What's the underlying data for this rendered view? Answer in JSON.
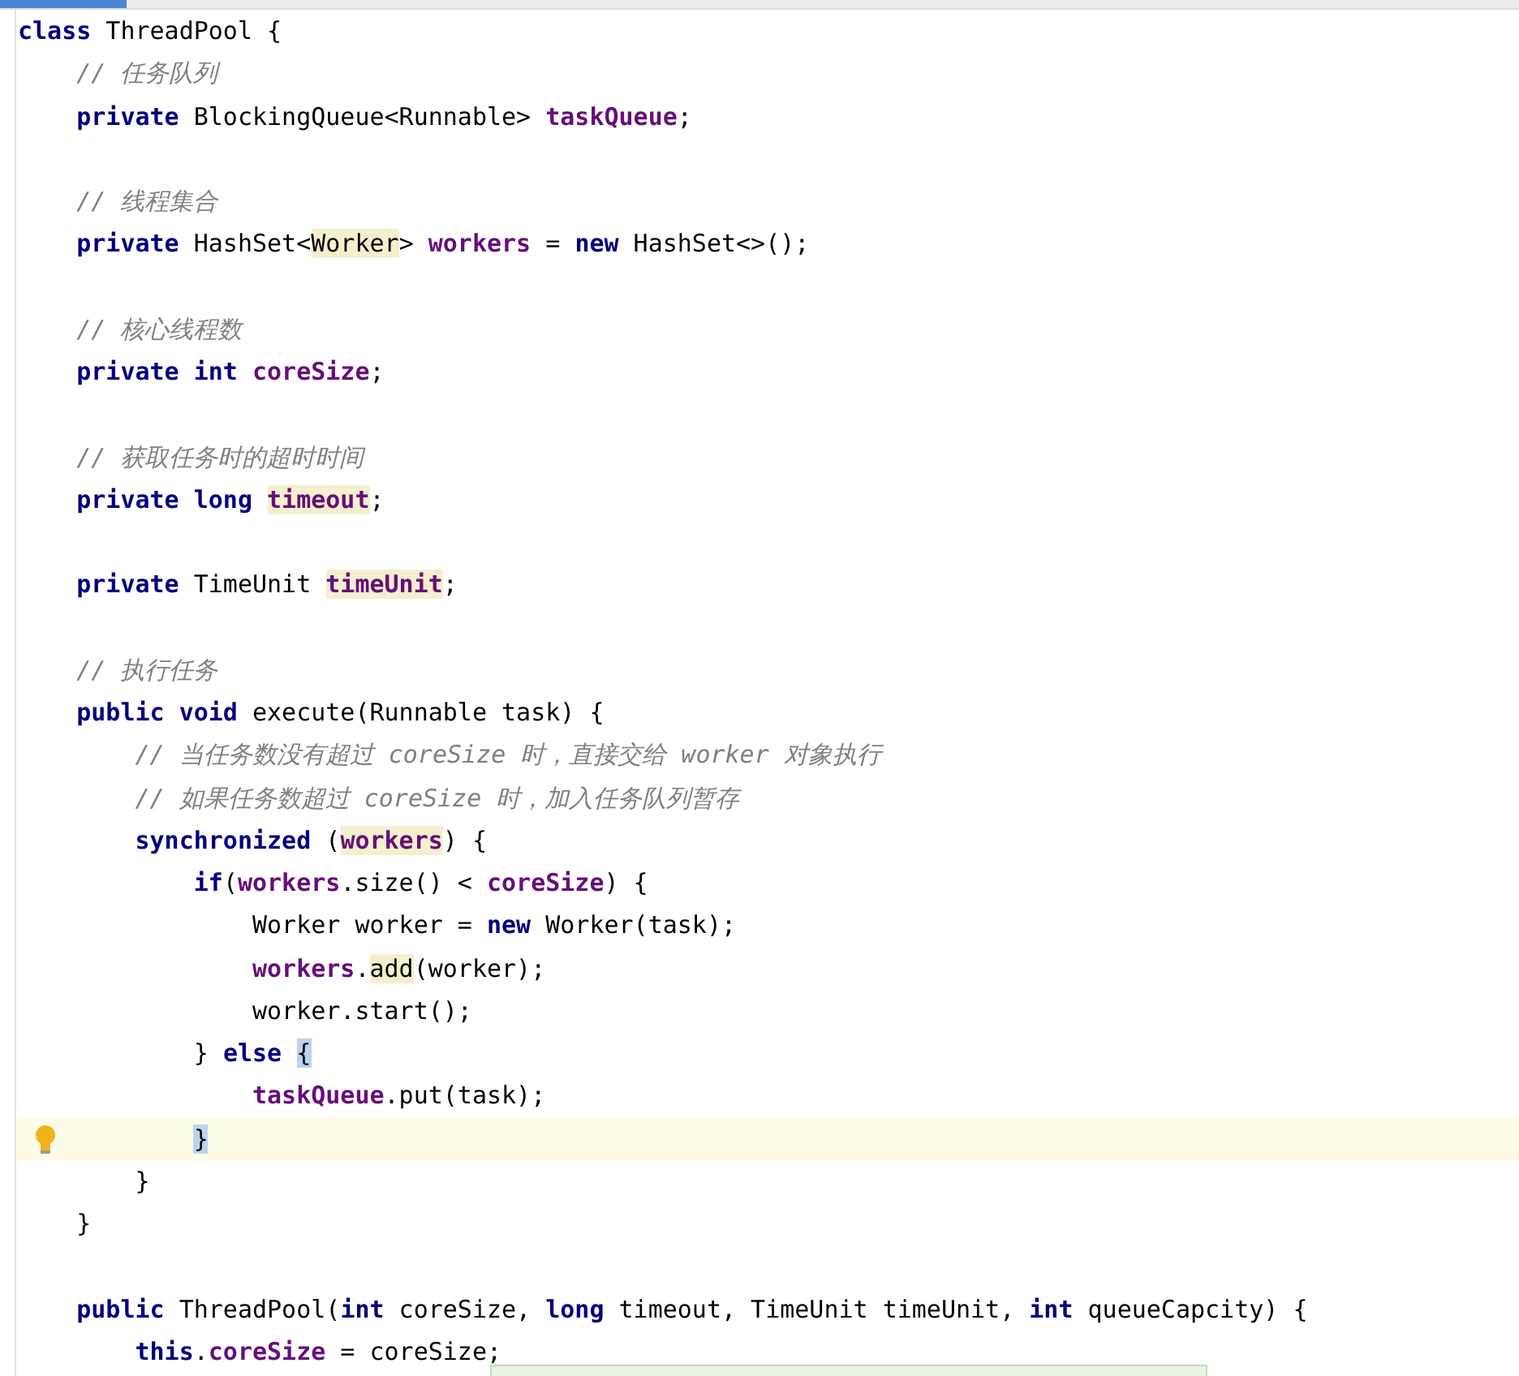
{
  "editor": {
    "lines": [
      {
        "current": false,
        "tokens": [
          {
            "kind": "kw",
            "text": "class"
          },
          {
            "kind": "plain",
            "text": " ThreadPool {"
          }
        ]
      },
      {
        "current": false,
        "tokens": [
          {
            "kind": "comment",
            "text": "    // 任务队列"
          }
        ]
      },
      {
        "current": false,
        "tokens": [
          {
            "kind": "kw",
            "text": "    private"
          },
          {
            "kind": "plain",
            "text": " BlockingQueue<Runnable> "
          },
          {
            "kind": "field",
            "text": "taskQueue"
          },
          {
            "kind": "plain",
            "text": ";"
          }
        ]
      },
      {
        "current": false
      },
      {
        "current": false,
        "tokens": [
          {
            "kind": "comment",
            "text": "    // 线程集合"
          }
        ]
      },
      {
        "current": false,
        "tokens": [
          {
            "kind": "kw",
            "text": "    private"
          },
          {
            "kind": "plain",
            "text": " HashSet<"
          },
          {
            "kind": "plain",
            "text": "Worker",
            "highlighted": true
          },
          {
            "kind": "plain",
            "text": "> "
          },
          {
            "kind": "field",
            "text": "workers"
          },
          {
            "kind": "plain",
            "text": " = "
          },
          {
            "kind": "kw",
            "text": "new"
          },
          {
            "kind": "plain",
            "text": " HashSet<>();"
          }
        ]
      },
      {
        "current": false
      },
      {
        "current": false,
        "tokens": [
          {
            "kind": "comment",
            "text": "    // 核心线程数"
          }
        ]
      },
      {
        "current": false,
        "tokens": [
          {
            "kind": "kw",
            "text": "    private int "
          },
          {
            "kind": "field",
            "text": "coreSize"
          },
          {
            "kind": "plain",
            "text": ";"
          }
        ]
      },
      {
        "current": false
      },
      {
        "current": false,
        "tokens": [
          {
            "kind": "comment",
            "text": "    // 获取任务时的超时时间"
          }
        ]
      },
      {
        "current": false,
        "tokens": [
          {
            "kind": "kw",
            "text": "    private long "
          },
          {
            "kind": "field",
            "text": "timeout",
            "highlighted": true
          },
          {
            "kind": "plain",
            "text": ";"
          }
        ]
      },
      {
        "current": false
      },
      {
        "current": false,
        "tokens": [
          {
            "kind": "kw",
            "text": "    private"
          },
          {
            "kind": "plain",
            "text": " TimeUnit "
          },
          {
            "kind": "field",
            "text": "timeUnit",
            "highlighted": true
          },
          {
            "kind": "plain",
            "text": ";"
          }
        ]
      },
      {
        "current": false
      },
      {
        "current": false,
        "tokens": [
          {
            "kind": "comment",
            "text": "    // 执行任务"
          }
        ]
      },
      {
        "current": false,
        "tokens": [
          {
            "kind": "kw",
            "text": "    public void"
          },
          {
            "kind": "plain",
            "text": " execute(Runnable task) {"
          }
        ]
      },
      {
        "current": false,
        "tokens": [
          {
            "kind": "comment",
            "text": "        // 当任务数没有超过 coreSize 时，直接交给 worker 对象执行"
          }
        ]
      },
      {
        "current": false,
        "tokens": [
          {
            "kind": "comment",
            "text": "        // 如果任务数超过 coreSize 时，加入任务队列暂存"
          }
        ]
      },
      {
        "current": false,
        "tokens": [
          {
            "kind": "kw",
            "text": "        synchronized"
          },
          {
            "kind": "plain",
            "text": " ("
          },
          {
            "kind": "field",
            "text": "workers",
            "highlighted": true
          },
          {
            "kind": "plain",
            "text": ") {"
          }
        ]
      },
      {
        "current": false,
        "tokens": [
          {
            "kind": "kw",
            "text": "            if"
          },
          {
            "kind": "plain",
            "text": "("
          },
          {
            "kind": "field",
            "text": "workers"
          },
          {
            "kind": "plain",
            "text": ".size() < "
          },
          {
            "kind": "field",
            "text": "coreSize"
          },
          {
            "kind": "plain",
            "text": ") {"
          }
        ]
      },
      {
        "current": false,
        "tokens": [
          {
            "kind": "plain",
            "text": "                Worker worker = "
          },
          {
            "kind": "kw",
            "text": "new"
          },
          {
            "kind": "plain",
            "text": " Worker(task);"
          }
        ]
      },
      {
        "current": false,
        "tokens": [
          {
            "kind": "field",
            "text": "                workers"
          },
          {
            "kind": "plain",
            "text": "."
          },
          {
            "kind": "plain",
            "text": "add",
            "highlighted": true
          },
          {
            "kind": "plain",
            "text": "(worker);"
          }
        ]
      },
      {
        "current": false,
        "tokens": [
          {
            "kind": "plain",
            "text": "                worker.start();"
          }
        ]
      },
      {
        "current": false,
        "tokens": [
          {
            "kind": "plain",
            "text": "            } "
          },
          {
            "kind": "kw",
            "text": "else "
          },
          {
            "kind": "brace",
            "text": "{",
            "matched": true
          }
        ]
      },
      {
        "current": false,
        "tokens": [
          {
            "kind": "field",
            "text": "                taskQueue"
          },
          {
            "kind": "plain",
            "text": ".put(task);"
          }
        ]
      },
      {
        "current": true,
        "tokens": [
          {
            "kind": "brace",
            "text": "            }",
            "matched": true
          }
        ]
      },
      {
        "current": false,
        "tokens": [
          {
            "kind": "plain",
            "text": "        }"
          }
        ]
      },
      {
        "current": false,
        "tokens": [
          {
            "kind": "plain",
            "text": "    }"
          }
        ]
      },
      {
        "current": false
      },
      {
        "current": false,
        "tokens": [
          {
            "kind": "kw",
            "text": "    public"
          },
          {
            "kind": "plain",
            "text": " ThreadPool("
          },
          {
            "kind": "kw",
            "text": "int"
          },
          {
            "kind": "plain",
            "text": " coreSize, "
          },
          {
            "kind": "kw",
            "text": "long"
          },
          {
            "kind": "plain",
            "text": " timeout, TimeUnit timeUnit, "
          },
          {
            "kind": "kw",
            "text": "int"
          },
          {
            "kind": "plain",
            "text": " queueCapcity) {"
          }
        ]
      },
      {
        "current": false,
        "tokens": [
          {
            "kind": "kw",
            "text": "        this"
          },
          {
            "kind": "plain",
            "text": "."
          },
          {
            "kind": "field",
            "text": "coreSize"
          },
          {
            "kind": "plain",
            "text": " = coreSize;"
          }
        ]
      }
    ]
  }
}
